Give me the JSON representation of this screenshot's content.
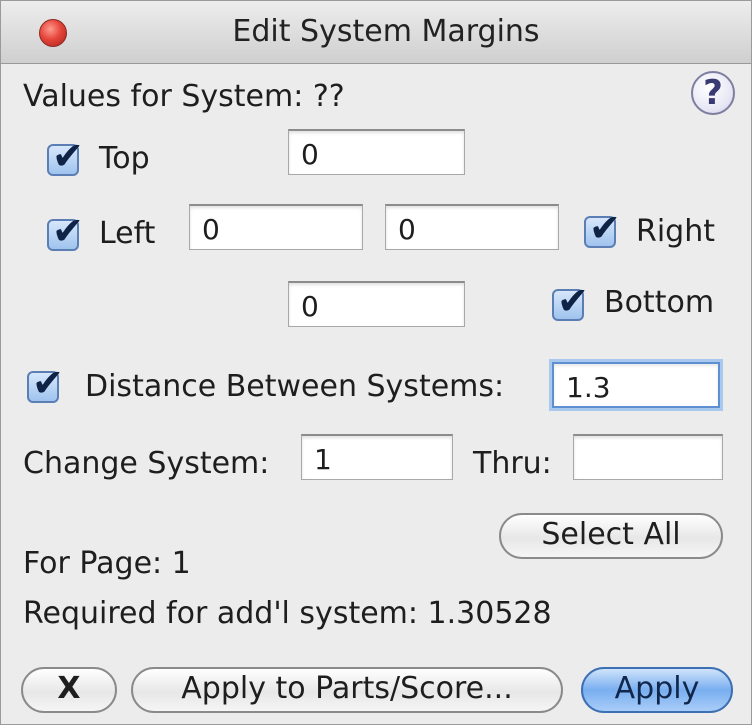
{
  "window": {
    "title": "Edit System Margins"
  },
  "help": {
    "label": "?"
  },
  "values_label": "Values for System: ??",
  "margins": {
    "top": {
      "label": "Top",
      "checked": true,
      "value": "0"
    },
    "left": {
      "label": "Left",
      "checked": true,
      "value": "0"
    },
    "right": {
      "label": "Right",
      "checked": true,
      "value": "0"
    },
    "bottom": {
      "label": "Bottom",
      "checked": true,
      "value": "0"
    }
  },
  "distance": {
    "label": "Distance Between Systems:",
    "checked": true,
    "value": "1.3"
  },
  "change_system": {
    "label": "Change System:",
    "value": "1"
  },
  "thru": {
    "label": "Thru:",
    "value": ""
  },
  "select_all_label": "Select All",
  "for_page": "For Page:  1",
  "required": "Required for add'l system: 1.30528",
  "buttons": {
    "cancel": "X",
    "apply_parts": "Apply to Parts/Score...",
    "apply": "Apply"
  },
  "colors": {
    "accent": "#79aef0",
    "focus": "#5d8fd1",
    "close": "#e6463b"
  }
}
